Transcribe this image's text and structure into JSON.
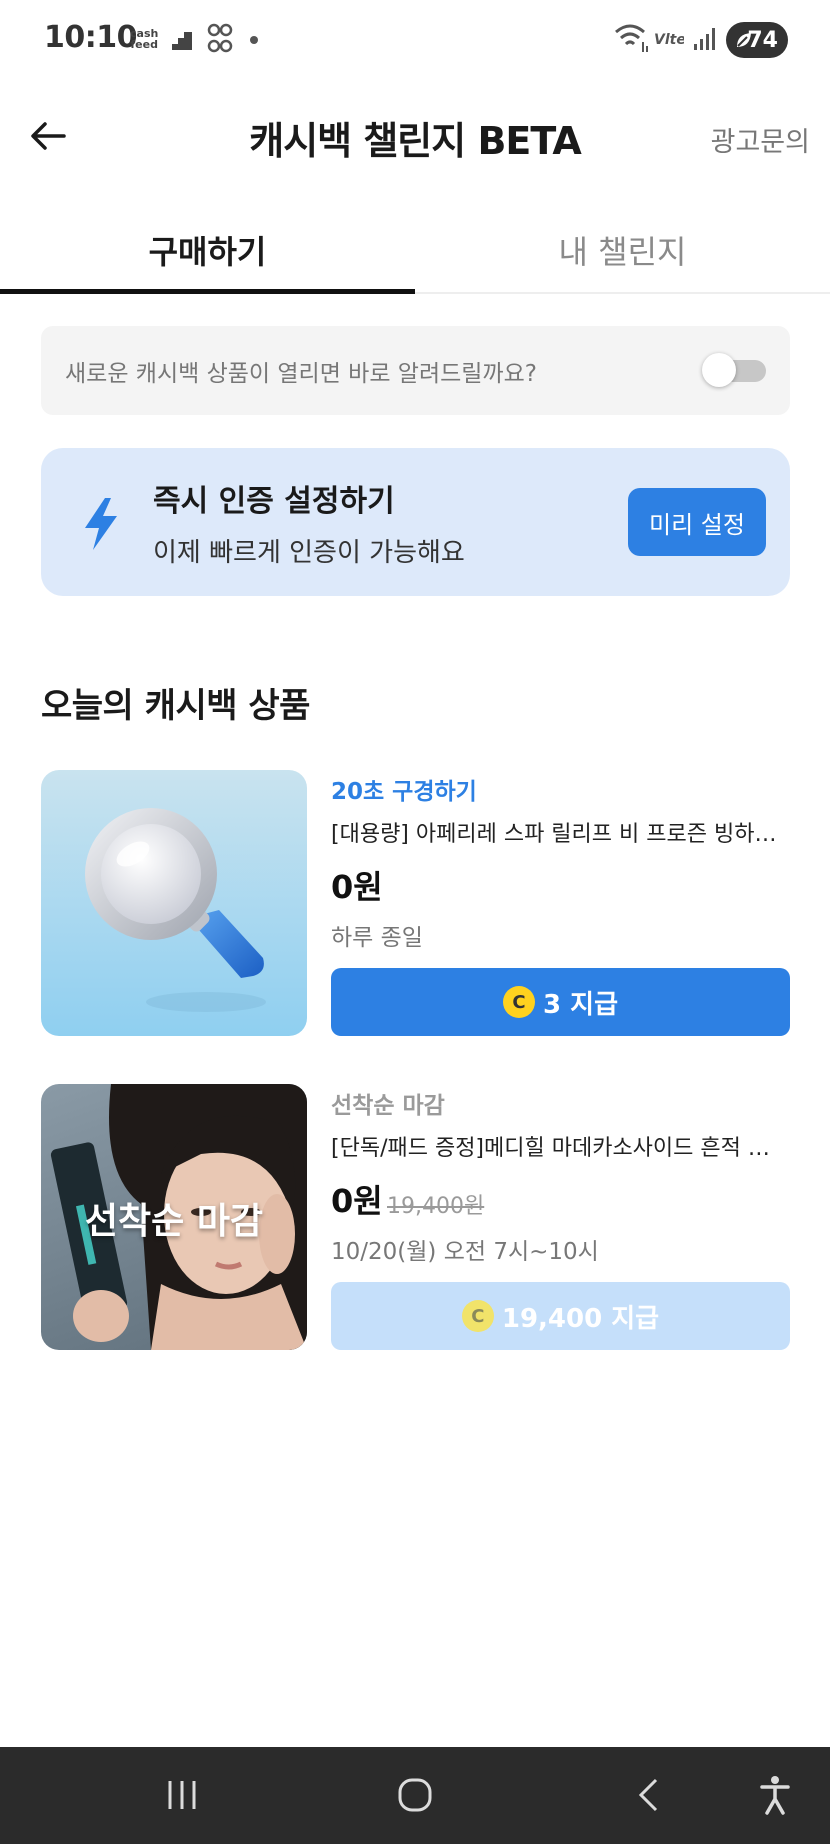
{
  "status_bar": {
    "time": "10:10",
    "cashfeed_top": "cash",
    "cashfeed_bottom": "feed",
    "battery": "74"
  },
  "header": {
    "title": "캐시백 챌린지 BETA",
    "ad_inquiry": "광고문의",
    "back_icon": "arrow-left-icon"
  },
  "tabs": [
    {
      "label": "구매하기",
      "active": true
    },
    {
      "label": "내 챌린지",
      "active": false
    }
  ],
  "notify": {
    "text": "새로운 캐시백 상품이 열리면 바로 알려드릴까요?",
    "toggle_on": false
  },
  "auth_banner": {
    "title": "즉시 인증 설정하기",
    "subtitle": "이제 빠르게 인증이 가능해요",
    "button": "미리 설정",
    "icon": "lightning-bolt-icon"
  },
  "section_title": "오늘의 캐시백 상품",
  "products": [
    {
      "tagline": "20초 구경하기",
      "name": "[대용량] 아페리레 스파 릴리프 비 프로즌 빙하…",
      "price": "0원",
      "period": "하루 종일",
      "cta_coin": "C",
      "cta_label": "3 지급",
      "status": "active"
    },
    {
      "tagline": "선착순 마감",
      "name": "[단독/패드 증정]메디힐 마데카소사이드 흔적 …",
      "price": "0원",
      "original_price": "19,400원",
      "period": "10/20(월) 오전 7시~10시",
      "thumb_overlay": "선착순 마감",
      "cta_coin": "C",
      "cta_label": "19,400 지급",
      "status": "sold-out"
    }
  ],
  "colors": {
    "accent": "#2d80e3",
    "banner_bg": "#dde9fa",
    "disabled_cta": "#c5dffa",
    "coin": "#ffd21f"
  }
}
